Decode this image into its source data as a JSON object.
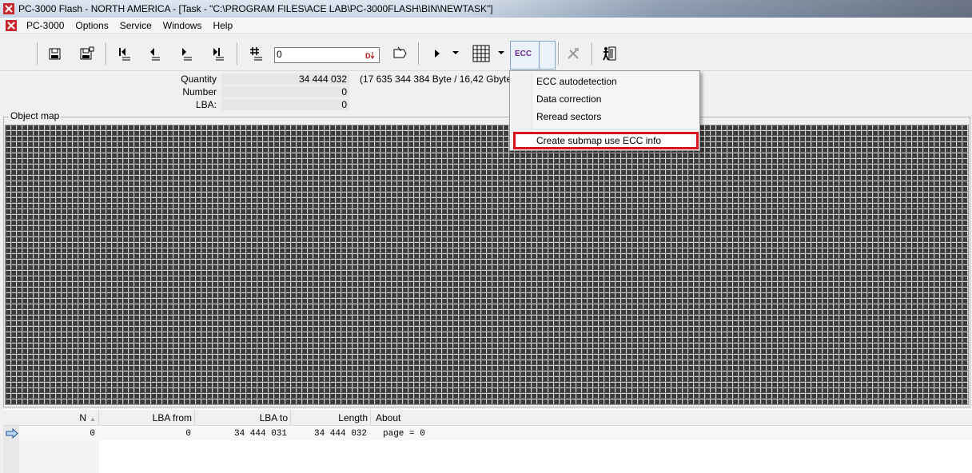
{
  "window": {
    "title": "PC-3000 Flash  - NORTH AMERICA - [Task - \"C:\\PROGRAM FILES\\ACE LAB\\PC-3000FLASH\\BIN\\NEWTASK\"]"
  },
  "menu": {
    "items": [
      "PC-3000",
      "Options",
      "Service",
      "Windows",
      "Help"
    ]
  },
  "toolbar": {
    "position_value": "0",
    "ecc_label": "ECC"
  },
  "info": {
    "quantity_label": "Quantity",
    "quantity_value": "34 444 032",
    "quantity_extra": "(17 635 344 384 Byte /  16,42 Gbytes",
    "number_label": "Number",
    "number_value": "0",
    "lba_label": "LBA:",
    "lba_value": "0"
  },
  "object_map": {
    "title": "Object map"
  },
  "table": {
    "columns": [
      "N",
      "LBA from",
      "LBA to",
      "Length",
      "About"
    ],
    "rows": [
      {
        "n": "0",
        "lba_from": "0",
        "lba_to": "34 444 031",
        "length": "34 444 032",
        "about": "page = 0"
      }
    ]
  },
  "ecc_menu": {
    "items": [
      "ECC autodetection",
      "Data correction",
      "Reread sectors",
      "Create submap use ECC info"
    ],
    "highlight_color": "#d8121e"
  }
}
